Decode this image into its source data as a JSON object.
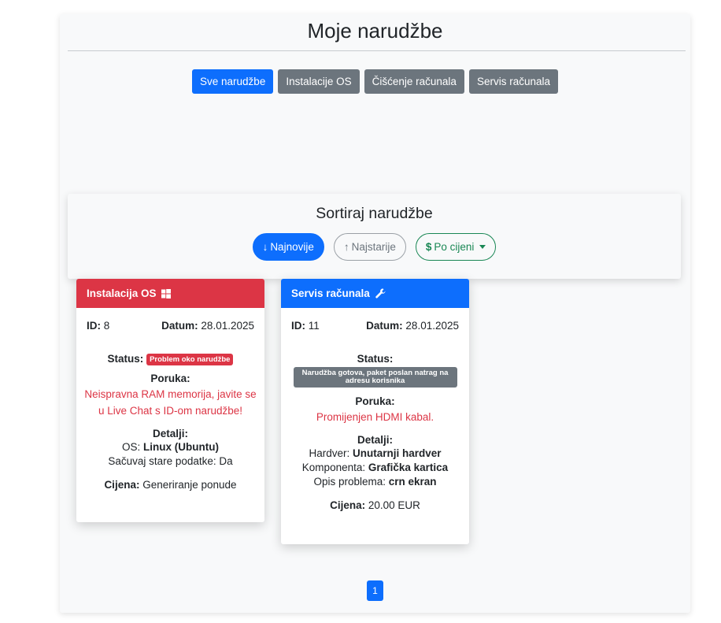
{
  "header": {
    "title": "Moje narudžbe"
  },
  "filters": [
    {
      "label": "Sve narudžbe"
    },
    {
      "label": "Instalacije OS"
    },
    {
      "label": "Čišćenje računala"
    },
    {
      "label": "Servis računala"
    }
  ],
  "sort": {
    "title": "Sortiraj narudžbe",
    "newest": {
      "icon": "↓",
      "label": "Najnovije"
    },
    "oldest": {
      "icon": "↑",
      "label": "Najstarije"
    },
    "price": {
      "icon": "$",
      "label": "Po cijeni"
    }
  },
  "orders": [
    {
      "header": "Instalacija OS",
      "icon": "windows-icon",
      "id_label": "ID:",
      "id": "8",
      "date_label": "Datum:",
      "date": "28.01.2025",
      "status_label": "Status:",
      "status": "Problem oko narudžbe",
      "message_label": "Poruka:",
      "message": "Neispravna RAM memorija, javite se u Live Chat s ID-om narudžbe!",
      "details_label": "Detalji:",
      "details": [
        {
          "key": "OS: ",
          "value": "Linux (Ubuntu)",
          "bold": true
        },
        {
          "key": "Sačuvaj stare podatke: ",
          "value": "Da",
          "bold": false
        }
      ],
      "price_label": "Cijena:",
      "price": "Generiranje ponude"
    },
    {
      "header": "Servis računala",
      "icon": "wrench-icon",
      "id_label": "ID:",
      "id": "11",
      "date_label": "Datum:",
      "date": "28.01.2025",
      "status_label": "Status:",
      "status": "Narudžba gotova, paket poslan natrag na adresu korisnika",
      "message_label": "Poruka:",
      "message": "Promijenjen HDMI kabal.",
      "details_label": "Detalji:",
      "details": [
        {
          "key": "Hardver: ",
          "value": "Unutarnji hardver",
          "bold": true
        },
        {
          "key": "Komponenta: ",
          "value": "Grafička kartica",
          "bold": true
        },
        {
          "key": "Opis problema: ",
          "value": "crn ekran",
          "bold": true
        }
      ],
      "price_label": "Cijena:",
      "price": "20.00 EUR"
    }
  ],
  "pagination": {
    "current": "1"
  },
  "colors": {
    "primary": "#0d6efd",
    "secondary": "#6c757d",
    "danger": "#dc3545",
    "success": "#198754"
  }
}
